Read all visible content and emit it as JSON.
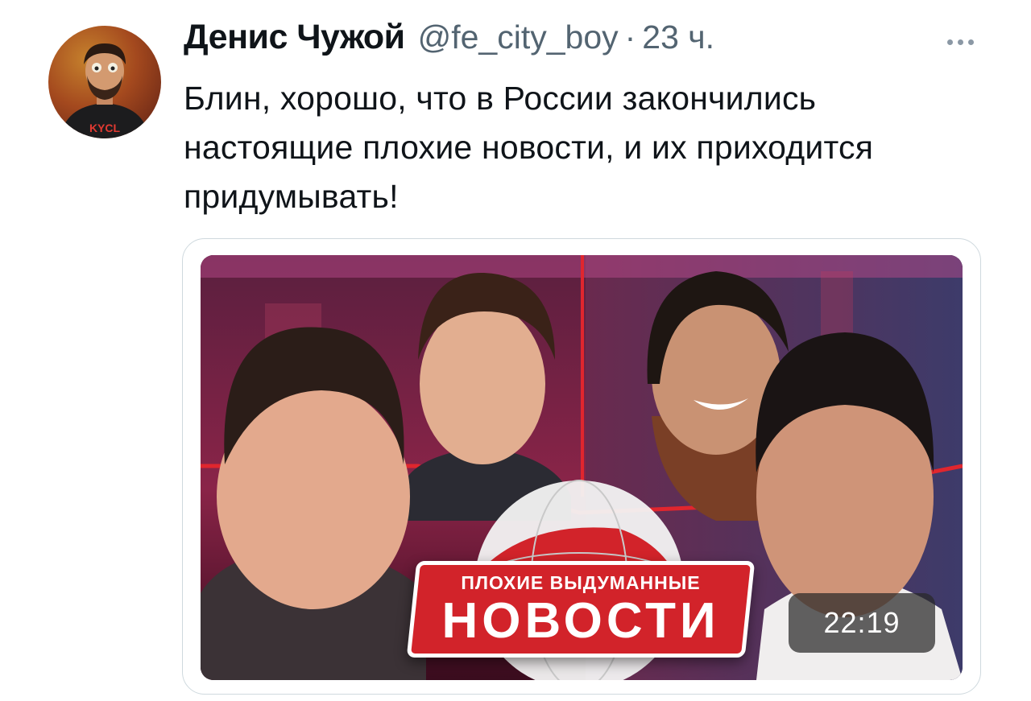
{
  "tweet": {
    "author_name": "Денис Чужой",
    "handle": "@fe_city_boy",
    "separator": "·",
    "time": "23 ч.",
    "text": "Блин, хорошо, что в России закончились настоящие плохие новости, и их приходится придумывать!"
  },
  "avatar": {
    "shirt_text": "KYCL"
  },
  "video": {
    "logo_line1": "ПЛОХИЕ ВЫДУМАННЫЕ",
    "logo_line2": "НОВОСТИ",
    "duration": "22:19"
  },
  "icons": {
    "more": "more-dots-icon"
  },
  "colors": {
    "text_primary": "#0f1419",
    "text_secondary": "#536471",
    "card_border": "#cfd9de",
    "logo_red": "#d2232a"
  }
}
